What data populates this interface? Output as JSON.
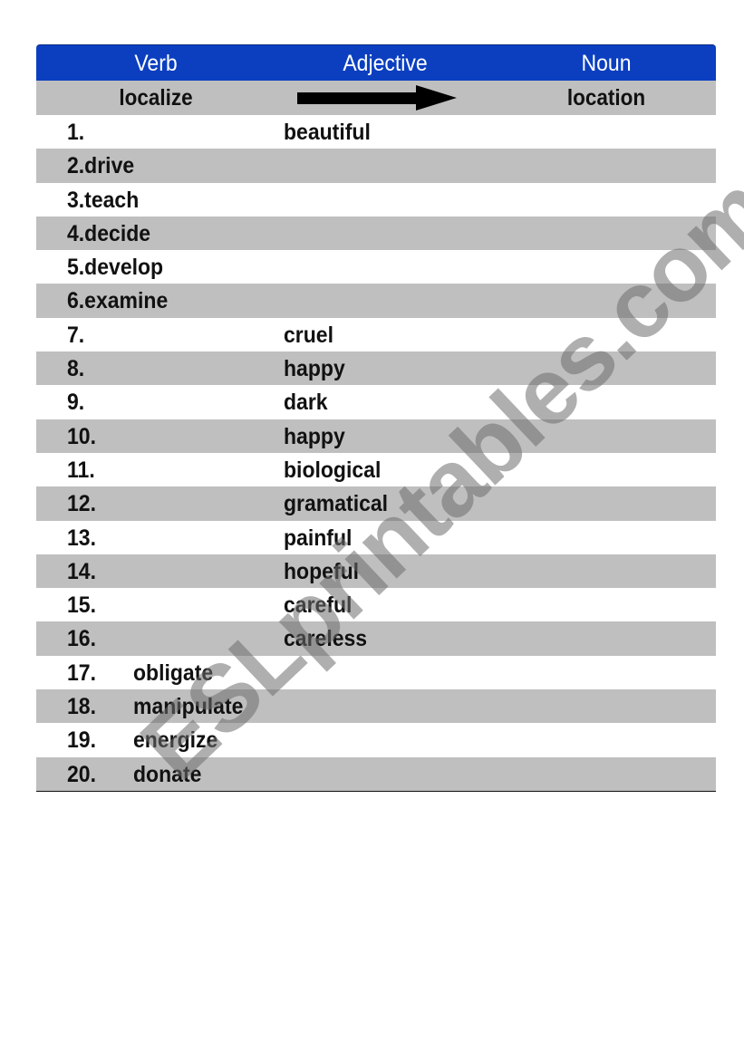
{
  "worksheet": {
    "header": {
      "verb": "Verb",
      "adjective": "Adjective",
      "noun": "Noun",
      "background_color": "#0b3fc0",
      "text_color": "#ffffff"
    },
    "example": {
      "verb": "localize",
      "adjective_icon": "right-arrow-icon",
      "noun": "location"
    },
    "row_colors": {
      "odd": "#ffffff",
      "even": "#bfbfbf"
    },
    "rows": [
      {
        "number": "1.",
        "verb": "",
        "adjective": "beautiful",
        "noun": "",
        "layout": "adjective"
      },
      {
        "number": "2.",
        "verb": "drive",
        "adjective": "",
        "noun": "",
        "layout": "inline-verb"
      },
      {
        "number": "3.",
        "verb": "teach",
        "adjective": "",
        "noun": "",
        "layout": "inline-verb"
      },
      {
        "number": "4.",
        "verb": "decide",
        "adjective": "",
        "noun": "",
        "layout": "inline-verb"
      },
      {
        "number": "5.",
        "verb": "develop",
        "adjective": "",
        "noun": "",
        "layout": "inline-verb"
      },
      {
        "number": "6.",
        "verb": "examine",
        "adjective": "",
        "noun": "",
        "layout": "inline-verb"
      },
      {
        "number": "7.",
        "verb": "",
        "adjective": "cruel",
        "noun": "",
        "layout": "adjective"
      },
      {
        "number": "8.",
        "verb": "",
        "adjective": "happy",
        "noun": "",
        "layout": "adjective"
      },
      {
        "number": "9.",
        "verb": "",
        "adjective": "dark",
        "noun": "",
        "layout": "adjective"
      },
      {
        "number": "10.",
        "verb": "",
        "adjective": "happy",
        "noun": "",
        "layout": "adjective"
      },
      {
        "number": "11.",
        "verb": "",
        "adjective": "biological",
        "noun": "",
        "layout": "adjective"
      },
      {
        "number": "12.",
        "verb": "",
        "adjective": "gramatical",
        "noun": "",
        "layout": "adjective"
      },
      {
        "number": "13.",
        "verb": "",
        "adjective": "painful",
        "noun": "",
        "layout": "adjective"
      },
      {
        "number": "14.",
        "verb": "",
        "adjective": "hopeful",
        "noun": "",
        "layout": "adjective"
      },
      {
        "number": "15.",
        "verb": "",
        "adjective": "careful",
        "noun": "",
        "layout": "adjective"
      },
      {
        "number": "16.",
        "verb": "",
        "adjective": "careless",
        "noun": "",
        "layout": "adjective"
      },
      {
        "number": "17.",
        "verb": "obligate",
        "adjective": "",
        "noun": "",
        "layout": "verb-column"
      },
      {
        "number": "18.",
        "verb": "manipulate",
        "adjective": "",
        "noun": "",
        "layout": "verb-column"
      },
      {
        "number": "19.",
        "verb": "energize",
        "adjective": "",
        "noun": "",
        "layout": "verb-column"
      },
      {
        "number": "20.",
        "verb": "donate",
        "adjective": "",
        "noun": "",
        "layout": "verb-column"
      }
    ]
  },
  "watermark": {
    "text": "ESLprintables.com"
  }
}
